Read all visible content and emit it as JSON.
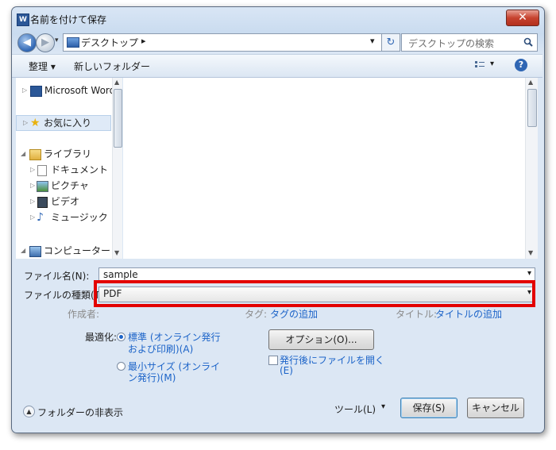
{
  "window": {
    "title": "名前を付けて保存",
    "icon_text": "W",
    "close_glyph": "✕"
  },
  "address": {
    "location": "デスクトップ",
    "separator": "▸",
    "dropdown_glyph": "▾",
    "refresh_glyph": "↻",
    "search_placeholder": "デスクトップの検索",
    "search_icon": "magnifier-icon"
  },
  "toolbar": {
    "organize": "整理 ▾",
    "new_folder": "新しいフォルダー",
    "view_glyph": "▾",
    "help": "?"
  },
  "nav": {
    "items": [
      {
        "label": "Microsoft Word",
        "icon": "word-icon"
      },
      {
        "label": "お気に入り",
        "icon": "star-icon"
      },
      {
        "label": "ライブラリ",
        "icon": "library-icon"
      },
      {
        "label": "ドキュメント",
        "icon": "document-icon"
      },
      {
        "label": "ピクチャ",
        "icon": "picture-icon"
      },
      {
        "label": "ビデオ",
        "icon": "video-icon"
      },
      {
        "label": "ミュージック",
        "icon": "music-icon"
      },
      {
        "label": "コンピューター",
        "icon": "computer-icon"
      }
    ]
  },
  "form": {
    "filename_label": "ファイル名(N):",
    "filename_value": "sample",
    "filetype_label": "ファイルの種類(T):",
    "filetype_value": "PDF",
    "author_label": "作成者:",
    "tags_label": "タグ:",
    "tags_value": "タグの追加",
    "title_label": "タイトル:",
    "title_value": "タイトルの追加"
  },
  "options": {
    "optimize_label": "最適化:",
    "standard_line1": "標準 (オンライン発行",
    "standard_line2": "および印刷)(A)",
    "minimum_line1": "最小サイズ (オンライ",
    "minimum_line2": "ン発行)(M)",
    "options_button": "オプション(O)...",
    "open_after_line1": "発行後にファイルを開く",
    "open_after_line2": "(E)",
    "optimize_selected": "standard",
    "open_after_checked": false
  },
  "footer": {
    "hide_folders": "フォルダーの非表示",
    "tools": "ツール(L)",
    "tools_glyph": "▾",
    "save": "保存(S)",
    "cancel": "キャンセル"
  },
  "colors": {
    "highlight": "#e30000",
    "link": "#1b63c8"
  }
}
